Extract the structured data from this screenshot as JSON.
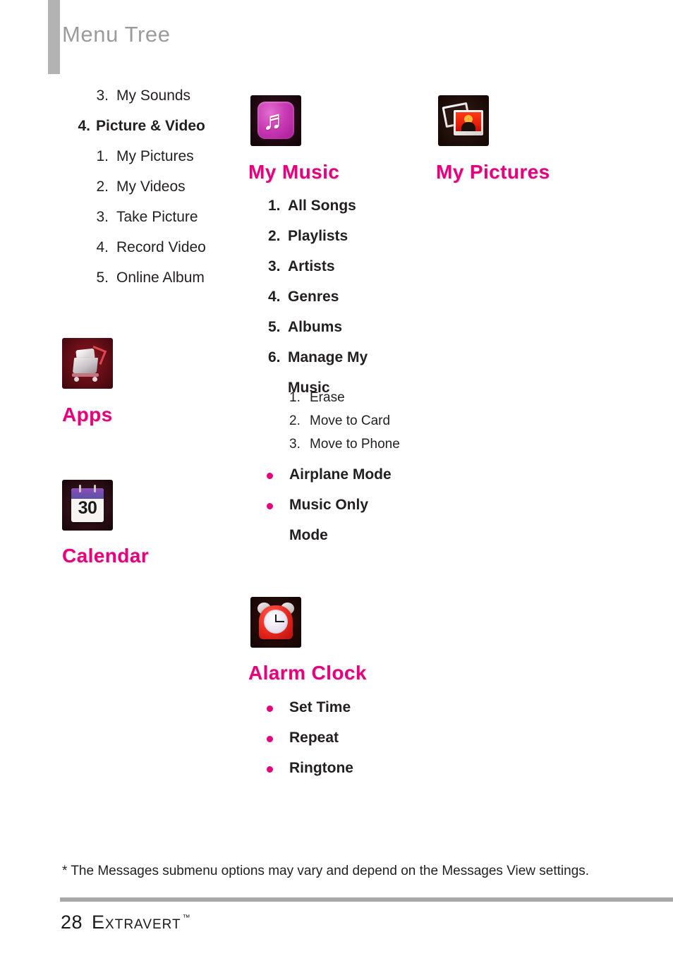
{
  "header": {
    "title": "Menu Tree"
  },
  "left_column": {
    "menu_items": [
      {
        "num": "3.",
        "label": "My Sounds",
        "level": 2
      },
      {
        "num": "4.",
        "label": "Picture & Video",
        "level": 1
      },
      {
        "num": "1.",
        "label": "My Pictures",
        "level": 2
      },
      {
        "num": "2.",
        "label": "My Videos",
        "level": 2
      },
      {
        "num": "3.",
        "label": "Take Picture",
        "level": 2
      },
      {
        "num": "4.",
        "label": "Record Video",
        "level": 2
      },
      {
        "num": "5.",
        "label": "Online Album",
        "level": 2
      }
    ],
    "apps": {
      "icon": "shopping-cart-icon",
      "title": "Apps"
    },
    "calendar": {
      "icon": "calendar-icon",
      "day": "30",
      "title": "Calendar"
    }
  },
  "middle_column": {
    "my_music": {
      "icon": "music-note-icon",
      "title": "My Music",
      "items": [
        {
          "num": "1.",
          "label": "All Songs"
        },
        {
          "num": "2.",
          "label": "Playlists"
        },
        {
          "num": "3.",
          "label": "Artists"
        },
        {
          "num": "4.",
          "label": "Genres"
        },
        {
          "num": "5.",
          "label": "Albums"
        },
        {
          "num": "6.",
          "label": "Manage My"
        }
      ],
      "item6_continuation": "Music",
      "manage_sub_items": [
        {
          "num": "1.",
          "label": "Erase"
        },
        {
          "num": "2.",
          "label": "Move to Card"
        },
        {
          "num": "3.",
          "label": "Move to Phone"
        }
      ],
      "bullets": [
        {
          "label": "Airplane Mode"
        },
        {
          "label": "Music Only"
        }
      ],
      "bullet2_continuation": "Mode"
    },
    "alarm_clock": {
      "icon": "alarm-clock-icon",
      "title": "Alarm Clock",
      "bullets": [
        {
          "label": "Set Time"
        },
        {
          "label": "Repeat"
        },
        {
          "label": "Ringtone"
        }
      ]
    }
  },
  "right_column": {
    "my_pictures": {
      "icon": "photos-icon",
      "title": "My Pictures"
    }
  },
  "footnote": "* The Messages submenu options may vary and depend on the Messages View settings.",
  "footer": {
    "page_number": "28",
    "brand": "Extravert",
    "trademark": "™"
  },
  "colors": {
    "accent_pink": "#e5007d",
    "header_gray": "#9b9b9b",
    "rule_gray": "#a7a7a7",
    "text": "#231f20"
  }
}
